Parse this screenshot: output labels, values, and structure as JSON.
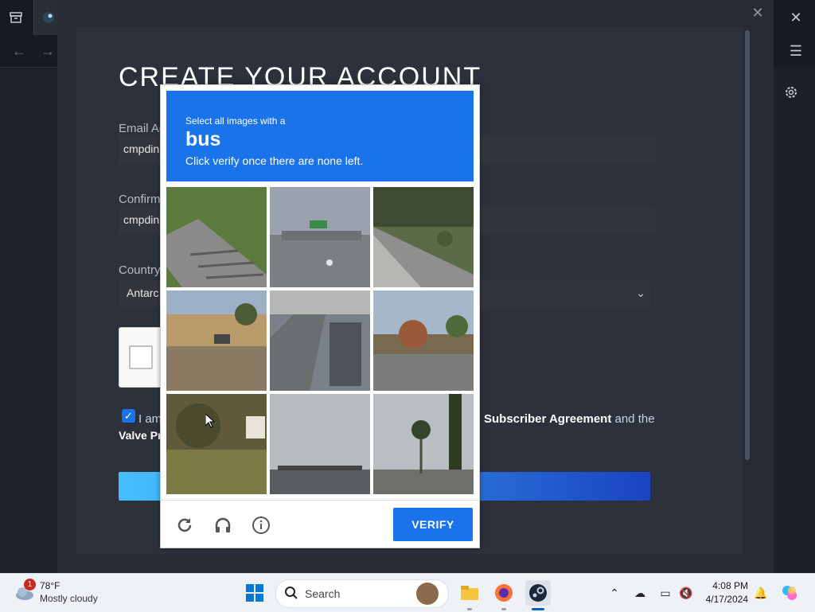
{
  "client": {
    "nav_back": "←",
    "nav_forward": "→",
    "menu": "☰",
    "close": "✕"
  },
  "dialog": {
    "close": "✕",
    "title": "CREATE YOUR ACCOUNT",
    "email_label": "Email Ac",
    "email_value": "cmpdin",
    "confirm_label": "Confirm",
    "confirm_value": "cmpdin",
    "country_label": "Country",
    "country_value": "Antarc",
    "agree_prefix": "I am",
    "agree_link": "Subscriber Agreement",
    "agree_suffix": "and the",
    "agree_line2": "Valve Pr"
  },
  "recaptcha": {
    "instruction": "Select all images with a",
    "target": "bus",
    "subtext": "Click verify once there are none left.",
    "verify_label": "VERIFY",
    "tiles": [
      {
        "name": "tile-steps"
      },
      {
        "name": "tile-highway-overpass"
      },
      {
        "name": "tile-sidewalk"
      },
      {
        "name": "tile-street-houses"
      },
      {
        "name": "tile-parked-motorcycles"
      },
      {
        "name": "tile-roadside-trees"
      },
      {
        "name": "tile-hedge-sign"
      },
      {
        "name": "tile-cloudy-lot"
      },
      {
        "name": "tile-palm-trees"
      }
    ]
  },
  "taskbar": {
    "weather_badge": "1",
    "weather_temp": "78°F",
    "weather_desc": "Mostly cloudy",
    "search_placeholder": "Search",
    "time": "4:08 PM",
    "date": "4/17/2024"
  },
  "colors": {
    "accent": "#1a73e8",
    "steam_bg": "#262a33"
  }
}
